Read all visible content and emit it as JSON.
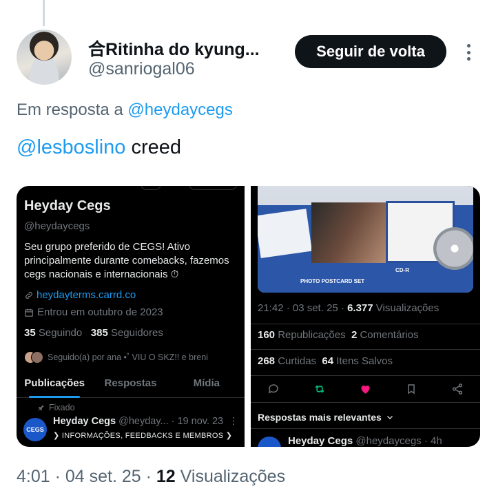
{
  "author": {
    "display_name": "合Ritinha do kyung...",
    "handle": "@sanriogal06",
    "follow_button": "Seguir de volta"
  },
  "reply": {
    "prefix": "Em resposta a ",
    "mention": "@heydaycegs"
  },
  "tweet": {
    "mention": "@lesboslino",
    "text": " creed"
  },
  "media_left": {
    "profile_name": "Heyday Cegs",
    "profile_handle": "@heydaycegs",
    "bio": "Seu grupo preferido de CEGS! Ativo principalmente durante comebacks, fazemos cegs nacionais e internacionais ⏱",
    "link": "heydayterms.carrd.co",
    "joined": "Entrou em outubro de 2023",
    "following_count": "35",
    "following_label": " Seguindo",
    "followers_count": "385",
    "followers_label": " Seguidores",
    "followed_by": "Seguido(a) por ana •˚ VIU O SKZ!! e breni",
    "tabs": [
      "Publicações",
      "Respostas",
      "Mídia"
    ],
    "pinned_label": "Fixado",
    "post_name": "Heyday Cegs",
    "post_meta": " @heyday... · 19 nov. 23",
    "post_avatar_text": "CEGS",
    "post_text": "❯ INFORMAÇÕES, FEEDBACKS E MEMBROS ❯"
  },
  "media_right": {
    "album_caption_1": "PHOTO POSTCARD SET",
    "album_caption_2": "CD-R",
    "meta_time": "21:42 · 03 set. 25 · ",
    "meta_views_count": "6.377",
    "meta_views_label": " Visualizações",
    "reposts_count": "160",
    "reposts_label": " Republicações",
    "comments_count": "2",
    "comments_label": " Comentários",
    "likes_count": "268",
    "likes_label": " Curtidas",
    "saves_count": "64",
    "saves_label": " Itens Salvos",
    "replies_header": "Respostas mais relevantes",
    "reply_name": "Heyday Cegs",
    "reply_meta": " @heydaycegs · 4h"
  },
  "footer": {
    "time": "4:01 · 04 set. 25 · ",
    "views_count": "12",
    "views_label": " Visualizações"
  },
  "colors": {
    "link": "#1d9bf0",
    "repost_green": "#00ba7c",
    "like_pink": "#f91880"
  }
}
